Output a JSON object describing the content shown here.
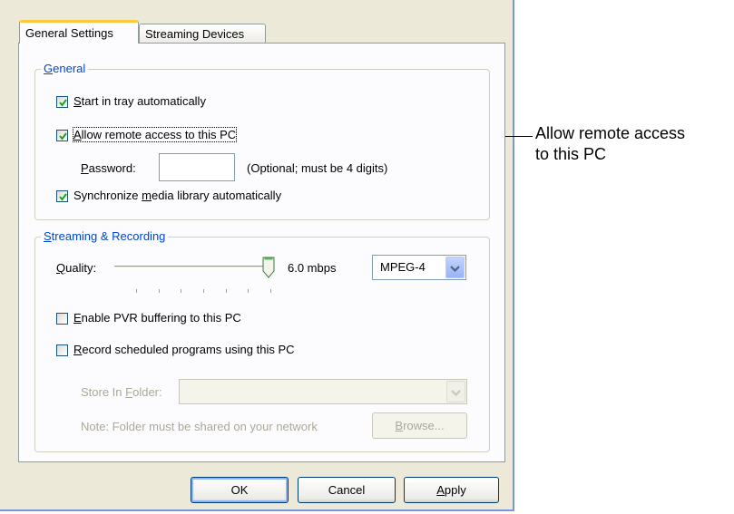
{
  "tabs": [
    {
      "label": "General Settings",
      "active": true
    },
    {
      "label": "Streaming Devices",
      "active": false
    }
  ],
  "general_group": {
    "title_accel": "G",
    "title_rest": "eneral",
    "start_in_tray": {
      "accel": "S",
      "rest": "tart in tray automatically",
      "checked": true
    },
    "allow_remote": {
      "accel": "A",
      "rest": "llow remote access to this PC",
      "checked": true
    },
    "password": {
      "accel": "P",
      "rest": "assword:",
      "value": "",
      "hint": "(Optional; must be 4 digits)"
    },
    "sync_library": {
      "pre": "Synchronize ",
      "accel": "m",
      "rest": "edia library automatically",
      "checked": true
    }
  },
  "streaming_group": {
    "title_accel": "S",
    "title_rest": "treaming & Recording",
    "quality": {
      "accel": "Q",
      "rest": "uality:",
      "rate": "6.0 mbps",
      "format": "MPEG-4",
      "slider_level": 1.0,
      "ticks": 7
    },
    "enable_pvr": {
      "accel": "E",
      "rest": "nable PVR buffering to this PC",
      "checked": false
    },
    "record_scheduled": {
      "accel": "R",
      "rest": "ecord scheduled programs using this PC",
      "checked": false
    },
    "store_folder": {
      "pre": "Store In ",
      "accel": "F",
      "rest": "older:",
      "value": ""
    },
    "note": "Note: Folder must be shared on your network",
    "browse": {
      "accel": "B",
      "rest": "rowse..."
    }
  },
  "footer": {
    "ok": "OK",
    "cancel": "Cancel",
    "apply_accel": "A",
    "apply_rest": "pply"
  },
  "annotation": {
    "line1": "Allow remote access",
    "line2": "to this PC"
  },
  "colors": {
    "dialog_bg": "#ece9d8",
    "panel_bg": "#fcfcfe",
    "group_title": "#0046d5",
    "check_mark": "#21a121",
    "active_tab_accent": "#ffc83c"
  }
}
